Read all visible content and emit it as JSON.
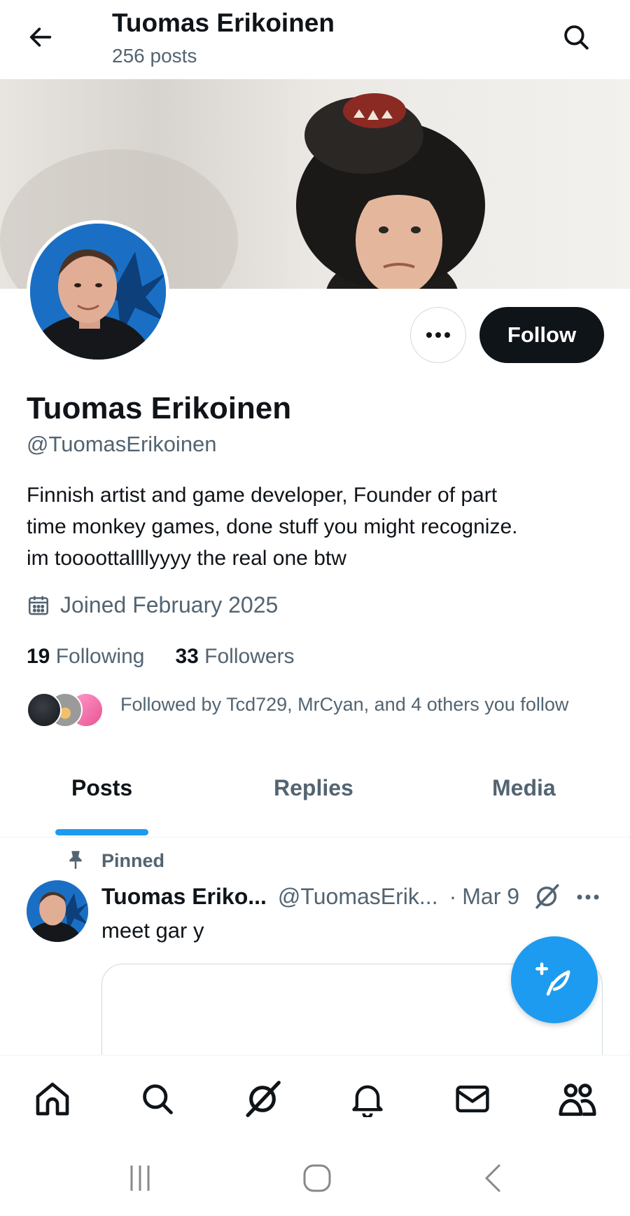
{
  "header": {
    "title": "Tuomas Erikoinen",
    "post_count": "256 posts"
  },
  "profile": {
    "display_name": "Tuomas Erikoinen",
    "handle": "@TuomasErikoinen",
    "bio_lines": [
      "Finnish artist and game developer, Founder of part",
      "time monkey games, done stuff you might recognize.",
      "im toooottallllyyyy the real one btw"
    ],
    "joined": "Joined February 2025",
    "following_count": "19",
    "following_label": "Following",
    "followers_count": "33",
    "followers_label": "Followers",
    "followed_by": "Followed by Tcd729, MrCyan, and 4 others you follow",
    "follow_label": "Follow"
  },
  "tabs": [
    {
      "label": "Posts",
      "active": true
    },
    {
      "label": "Replies",
      "active": false
    },
    {
      "label": "Media",
      "active": false
    }
  ],
  "post": {
    "pinned_label": "Pinned",
    "author_name": "Tuomas Eriko...",
    "author_handle": "@TuomasErik...",
    "separator": "·",
    "date": "Mar 9",
    "text": "meet gar y"
  },
  "icons": {
    "back": "arrow-left-icon",
    "search": "search-icon",
    "more": "ellipsis-icon",
    "calendar": "calendar-icon",
    "pin": "pin-icon",
    "grok": "grok-icon",
    "compose": "compose-post-icon",
    "nav": [
      "home-icon",
      "search-icon",
      "grok-icon",
      "bell-icon",
      "mail-icon",
      "communities-icon"
    ],
    "system": [
      "recents-icon",
      "home-circle-icon",
      "back-chevron-icon"
    ]
  },
  "colors": {
    "accent": "#1d9bf0",
    "text_primary": "#0f1419",
    "text_secondary": "#536471",
    "follow_button": "#0f1419"
  }
}
